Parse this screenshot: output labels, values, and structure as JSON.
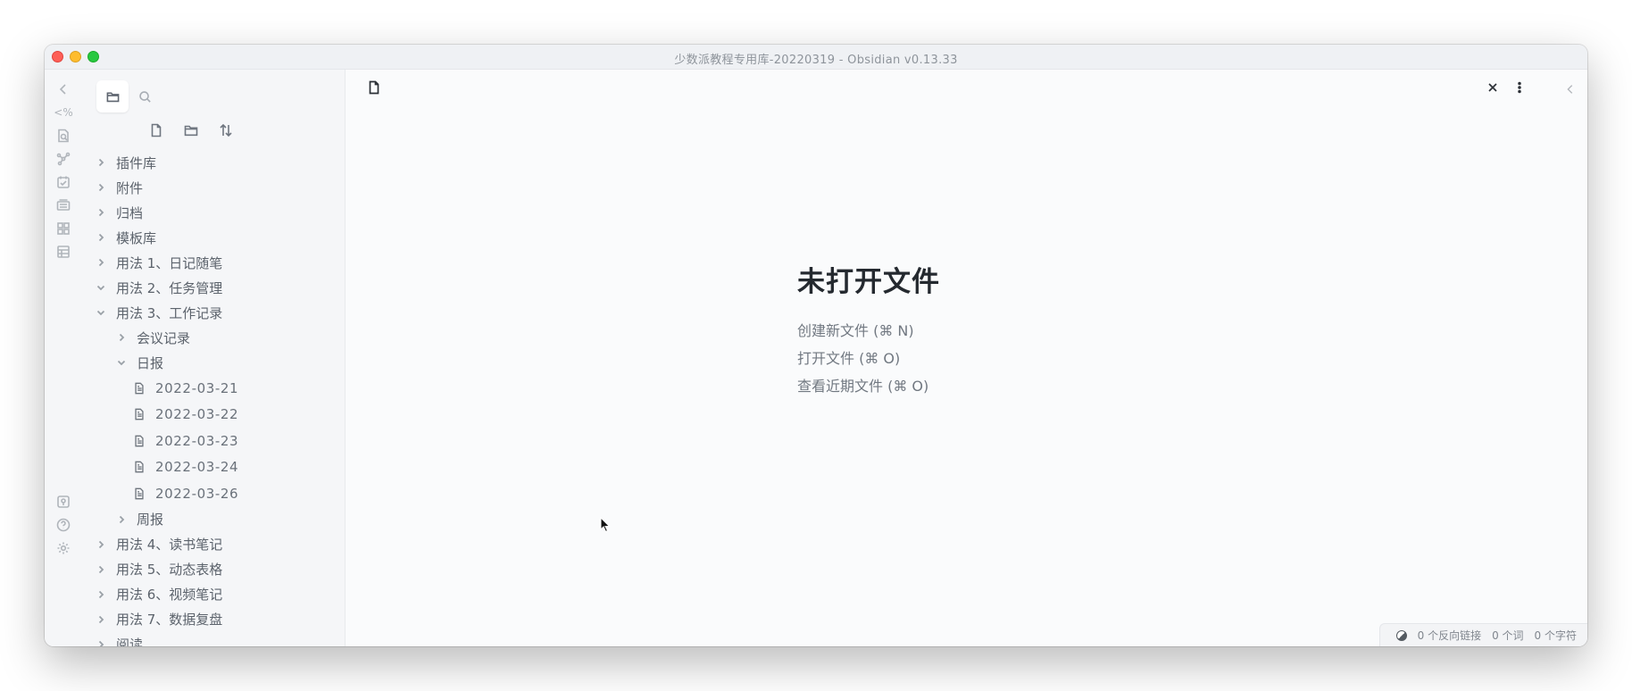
{
  "window": {
    "title": "少数派教程专用库-20220319 - Obsidian v0.13.33"
  },
  "ribbon": {
    "items": [
      {
        "name": "collapse-left-icon"
      },
      {
        "name": "templater-icon",
        "text": "<%"
      },
      {
        "name": "quick-switcher-icon"
      },
      {
        "name": "graph-view-icon"
      },
      {
        "name": "daily-note-icon"
      },
      {
        "name": "slides-icon"
      },
      {
        "name": "workspaces-icon"
      },
      {
        "name": "table-icon"
      }
    ],
    "bottom_items": [
      {
        "name": "open-vault-icon"
      },
      {
        "name": "help-icon"
      },
      {
        "name": "settings-icon"
      }
    ]
  },
  "sidebar": {
    "tabs": [
      {
        "name": "file-explorer-tab",
        "icon": "folder-icon",
        "active": true
      },
      {
        "name": "search-tab",
        "icon": "search-icon",
        "active": false
      }
    ],
    "actions": [
      {
        "name": "new-note-button",
        "icon": "file-plus-icon"
      },
      {
        "name": "new-folder-button",
        "icon": "folder-plus-icon"
      },
      {
        "name": "sort-button",
        "icon": "sort-icon"
      }
    ],
    "tree": [
      {
        "label": "插件库",
        "type": "folder",
        "level": 0,
        "expanded": false
      },
      {
        "label": "附件",
        "type": "folder",
        "level": 0,
        "expanded": false
      },
      {
        "label": "归档",
        "type": "folder",
        "level": 0,
        "expanded": false
      },
      {
        "label": "模板库",
        "type": "folder",
        "level": 0,
        "expanded": false
      },
      {
        "label": "用法 1、日记随笔",
        "type": "folder",
        "level": 0,
        "expanded": false
      },
      {
        "label": "用法 2、任务管理",
        "type": "folder",
        "level": 0,
        "expanded": true
      },
      {
        "label": "用法 3、工作记录",
        "type": "folder",
        "level": 0,
        "expanded": true
      },
      {
        "label": "会议记录",
        "type": "folder",
        "level": 1,
        "expanded": false
      },
      {
        "label": "日报",
        "type": "folder",
        "level": 1,
        "expanded": true
      },
      {
        "label": "2022-03-21",
        "type": "file",
        "level": 2
      },
      {
        "label": "2022-03-22",
        "type": "file",
        "level": 2
      },
      {
        "label": "2022-03-23",
        "type": "file",
        "level": 2
      },
      {
        "label": "2022-03-24",
        "type": "file",
        "level": 2
      },
      {
        "label": "2022-03-26",
        "type": "file",
        "level": 2
      },
      {
        "label": "周报",
        "type": "folder",
        "level": 1,
        "expanded": false
      },
      {
        "label": "用法 4、读书笔记",
        "type": "folder",
        "level": 0,
        "expanded": false
      },
      {
        "label": "用法 5、动态表格",
        "type": "folder",
        "level": 0,
        "expanded": false
      },
      {
        "label": "用法 6、视频笔记",
        "type": "folder",
        "level": 0,
        "expanded": false
      },
      {
        "label": "用法 7、数据复盘",
        "type": "folder",
        "level": 0,
        "expanded": false
      },
      {
        "label": "阅读",
        "type": "folder",
        "level": 0,
        "expanded": false
      }
    ]
  },
  "main": {
    "empty_state": {
      "title": "未打开文件",
      "actions": [
        "创建新文件 (⌘ N)",
        "打开文件 (⌘ O)",
        "查看近期文件 (⌘ O)"
      ]
    },
    "header": {
      "close_icon": "close-icon",
      "more_icon": "more-options-icon"
    }
  },
  "statusbar": {
    "backlinks": "0 个反向链接",
    "words": "0 个词",
    "chars": "0 个字符"
  }
}
